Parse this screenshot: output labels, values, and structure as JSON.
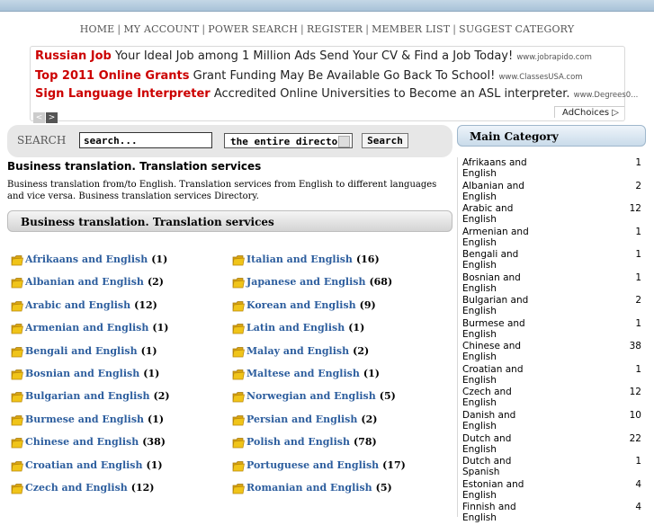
{
  "nav": {
    "items": [
      "HOME",
      "MY ACCOUNT",
      "POWER SEARCH",
      "REGISTER",
      "MEMBER LIST",
      "SUGGEST CATEGORY"
    ],
    "separator": "|"
  },
  "ads": [
    {
      "title": "Russian Job",
      "text": "Your Ideal Job among 1 Million Ads Send Your CV & Find a Job Today!",
      "url": "www.jobrapido.com"
    },
    {
      "title": "Top 2011 Online Grants",
      "text": "Grant Funding May Be Available Go Back To School!",
      "url": "www.ClassesUSA.com"
    },
    {
      "title": "Sign Language Interpreter",
      "text": "Accredited Online Universities to Become an ASL interpreter.",
      "url": "www.Degrees0..."
    }
  ],
  "ad_nav": {
    "prev": "<",
    "next": ">"
  },
  "adchoices": "AdChoices ▷",
  "search": {
    "label": "SEARCH",
    "value": "search...",
    "scope": "the entire directory",
    "button": "Search"
  },
  "page": {
    "title": "Business translation. Translation services",
    "description": "Business translation from/to English. Translation services from English to different languages and vice versa. Business translation services Directory.",
    "section_title": "Business translation. Translation services"
  },
  "categories_col1": [
    {
      "name": "Afrikaans and English",
      "count": "(1)"
    },
    {
      "name": "Albanian and English",
      "count": "(2)"
    },
    {
      "name": "Arabic and English",
      "count": "(12)"
    },
    {
      "name": "Armenian and English",
      "count": "(1)"
    },
    {
      "name": "Bengali and English",
      "count": "(1)"
    },
    {
      "name": "Bosnian and English",
      "count": "(1)"
    },
    {
      "name": "Bulgarian and English",
      "count": "(2)"
    },
    {
      "name": "Burmese and English",
      "count": "(1)"
    },
    {
      "name": "Chinese and English",
      "count": "(38)"
    },
    {
      "name": "Croatian and English",
      "count": "(1)"
    },
    {
      "name": "Czech and English",
      "count": "(12)"
    }
  ],
  "categories_col2": [
    {
      "name": "Italian and English",
      "count": "(16)"
    },
    {
      "name": "Japanese and English",
      "count": "(68)"
    },
    {
      "name": "Korean and English",
      "count": "(9)"
    },
    {
      "name": "Latin and English",
      "count": "(1)"
    },
    {
      "name": "Malay and English",
      "count": "(2)"
    },
    {
      "name": "Maltese and English",
      "count": "(1)"
    },
    {
      "name": "Norwegian and English",
      "count": "(5)"
    },
    {
      "name": "Persian and English",
      "count": "(2)"
    },
    {
      "name": "Polish and English",
      "count": "(78)"
    },
    {
      "name": "Portuguese and English",
      "count": "(17)"
    },
    {
      "name": "Romanian and English",
      "count": "(5)"
    }
  ],
  "sidebar": {
    "title": "Main Category",
    "items": [
      {
        "name": "Afrikaans and English",
        "count": "1"
      },
      {
        "name": "Albanian and English",
        "count": "2"
      },
      {
        "name": "Arabic and English",
        "count": "12"
      },
      {
        "name": "Armenian and English",
        "count": "1"
      },
      {
        "name": "Bengali and English",
        "count": "1"
      },
      {
        "name": "Bosnian and English",
        "count": "1"
      },
      {
        "name": "Bulgarian and English",
        "count": "2"
      },
      {
        "name": "Burmese and English",
        "count": "1"
      },
      {
        "name": "Chinese and English",
        "count": "38"
      },
      {
        "name": "Croatian and English",
        "count": "1"
      },
      {
        "name": "Czech and English",
        "count": "12"
      },
      {
        "name": "Danish and English",
        "count": "10"
      },
      {
        "name": "Dutch and English",
        "count": "22"
      },
      {
        "name": "Dutch and Spanish",
        "count": "1"
      },
      {
        "name": "Estonian and English",
        "count": "4"
      },
      {
        "name": "Finnish and English",
        "count": "4"
      }
    ]
  },
  "colors": {
    "link": "#2d5e9e",
    "ad_title": "#cc0000",
    "folder": "#f0c419"
  }
}
